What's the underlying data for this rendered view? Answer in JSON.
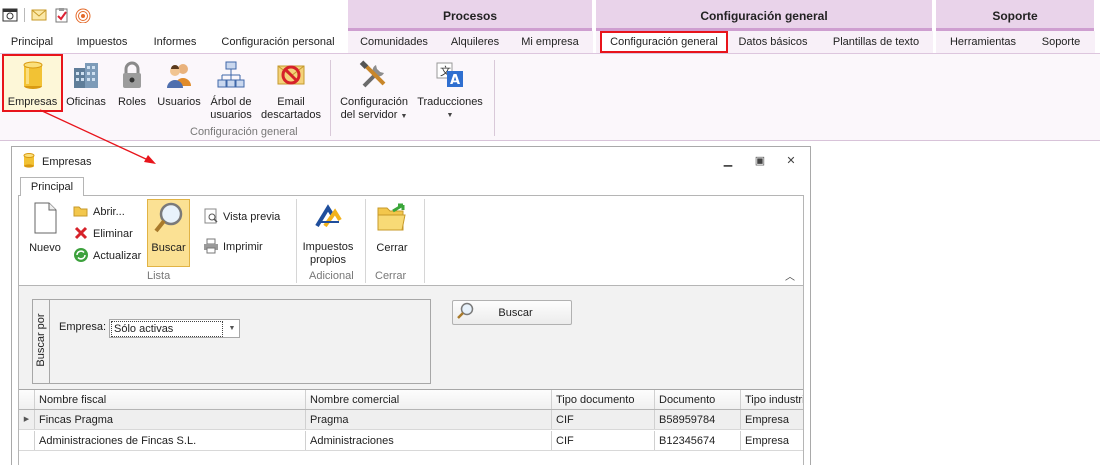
{
  "app": {
    "context_groups": {
      "procesos": "Procesos",
      "configuracion": "Configuración general",
      "soporte": "Soporte"
    },
    "tabs": [
      {
        "label": "Principal"
      },
      {
        "label": "Impuestos"
      },
      {
        "label": "Informes"
      },
      {
        "label": "Configuración personal"
      },
      {
        "label": "Comunidades"
      },
      {
        "label": "Alquileres"
      },
      {
        "label": "Mi empresa"
      },
      {
        "label": "Configuración general",
        "active": true
      },
      {
        "label": "Datos básicos"
      },
      {
        "label": "Plantillas de texto"
      },
      {
        "label": "Herramientas"
      },
      {
        "label": "Soporte"
      }
    ],
    "ribbon": {
      "empresas": "Empresas",
      "oficinas": "Oficinas",
      "roles": "Roles",
      "usuarios": "Usuarios",
      "arbol_1": "Árbol de",
      "arbol_2": "usuarios",
      "email_1": "Email",
      "email_2": "descartados",
      "group_label": "Configuración general",
      "config_servidor_1": "Configuración",
      "config_servidor_2": "del servidor",
      "traducciones": "Traducciones"
    },
    "colors": {
      "context_tab_bg": "#e9d3ea",
      "highlight_border": "#e8141b",
      "buscar_active_bg": "#fbe194"
    }
  },
  "window": {
    "title": "Empresas",
    "tab": "Principal",
    "ribbon": {
      "nuevo": "Nuevo",
      "abrir": "Abrir...",
      "eliminar": "Eliminar",
      "actualizar": "Actualizar",
      "buscar": "Buscar",
      "vista_previa": "Vista previa",
      "imprimir": "Imprimir",
      "impuestos_1": "Impuestos",
      "impuestos_2": "propios",
      "cerrar": "Cerrar",
      "group_lista": "Lista",
      "group_adicional": "Adicional",
      "group_cerrar": "Cerrar"
    },
    "search": {
      "panel_label": "Buscar por",
      "empresa_label": "Empresa:",
      "empresa_value": "Sólo activas",
      "buscar_button": "Buscar"
    },
    "grid": {
      "columns": [
        "Nombre fiscal",
        "Nombre comercial",
        "Tipo documento",
        "Documento",
        "Tipo industri"
      ],
      "rows": [
        [
          "Fincas Pragma",
          "Pragma",
          "CIF",
          "B58959784",
          "Empresa"
        ],
        [
          "Administraciones de Fincas S.L.",
          "Administraciones",
          "CIF",
          "B12345674",
          "Empresa"
        ]
      ]
    }
  }
}
